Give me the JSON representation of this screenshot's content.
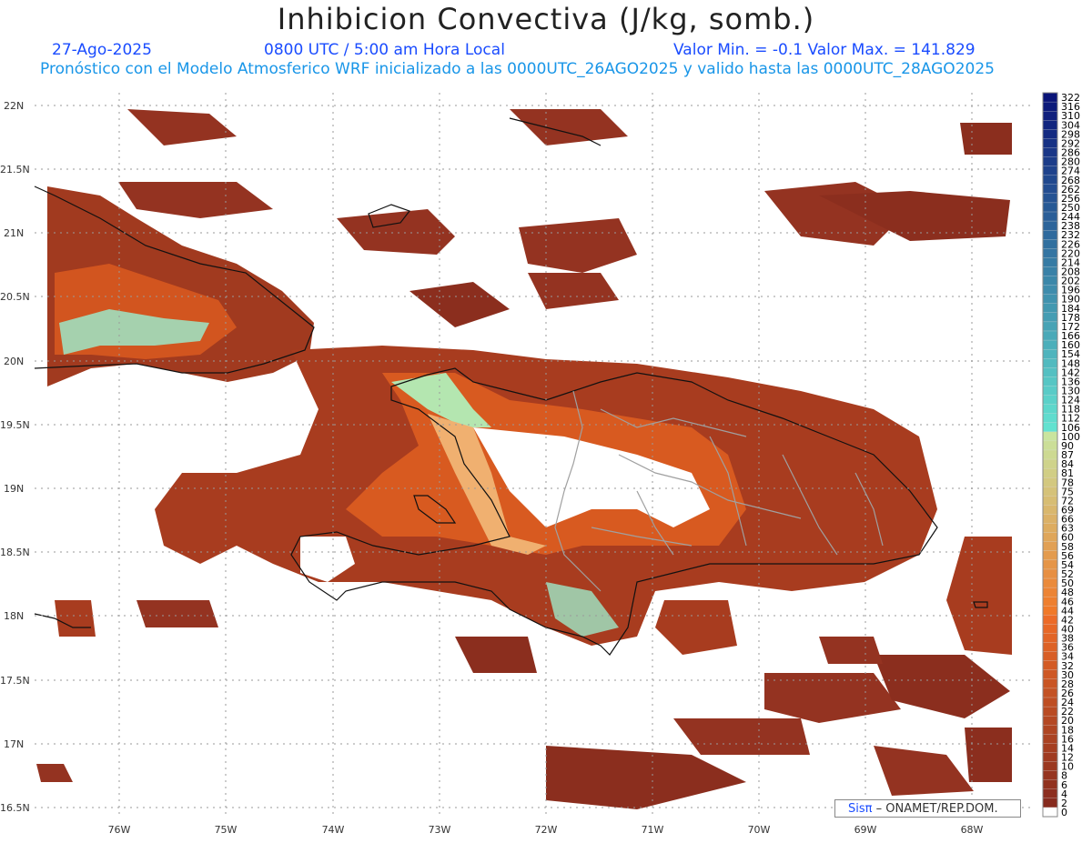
{
  "header": {
    "title": "Inhibicion Convectiva (J/kg, somb.)",
    "date": "27-Ago-2025",
    "time": "0800 UTC / 5:00 am Hora Local",
    "minmax": "Valor Min. = -0.1  Valor Max. = 141.829",
    "subtitle": "Pronóstico con el Modelo Atmosferico WRF inicializado a las 0000UTC_26AGO2025 y valido hasta las  0000UTC_28AGO2025"
  },
  "map": {
    "lat_labels": [
      "22N",
      "21.5N",
      "21N",
      "20.5N",
      "20N",
      "19.5N",
      "19N",
      "18.5N",
      "18N",
      "17.5N",
      "17N",
      "16.5N"
    ],
    "lon_labels": [
      "76W",
      "75W",
      "74W",
      "73W",
      "72W",
      "71W",
      "70W",
      "69W",
      "68W"
    ],
    "field_colors": {
      "low": "#8b2e1e",
      "mid": "#c8401a",
      "high": "#f07a2a",
      "peak": "#9ee8c8"
    }
  },
  "colorbar": {
    "labels": [
      "322",
      "316",
      "310",
      "304",
      "298",
      "292",
      "286",
      "280",
      "274",
      "268",
      "262",
      "256",
      "250",
      "244",
      "238",
      "232",
      "226",
      "220",
      "214",
      "208",
      "202",
      "196",
      "190",
      "184",
      "178",
      "172",
      "166",
      "160",
      "154",
      "148",
      "142",
      "136",
      "130",
      "124",
      "118",
      "112",
      "106",
      "100",
      "90",
      "87",
      "84",
      "81",
      "78",
      "75",
      "72",
      "69",
      "66",
      "63",
      "60",
      "58",
      "56",
      "54",
      "52",
      "50",
      "48",
      "46",
      "44",
      "42",
      "40",
      "38",
      "36",
      "34",
      "32",
      "30",
      "28",
      "26",
      "24",
      "22",
      "20",
      "18",
      "16",
      "14",
      "12",
      "10",
      "8",
      "6",
      "4",
      "2",
      "0"
    ]
  },
  "credit": {
    "brand": "Sisπ",
    "text": " – ONAMET/REP.DOM."
  }
}
